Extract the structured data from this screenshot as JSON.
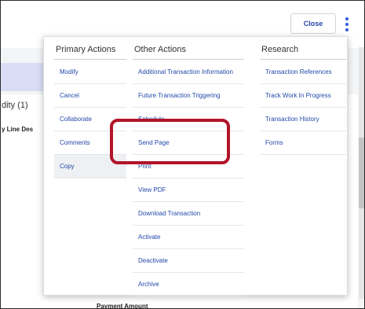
{
  "header": {
    "close_label": "Close"
  },
  "background": {
    "validity_label": "dity (1)",
    "line_desc_label": "y Line Des",
    "payment_amount_label": "Payment Amount"
  },
  "menu": {
    "primary": {
      "header": "Primary Actions",
      "items": [
        {
          "label": "Modify"
        },
        {
          "label": "Cancel"
        },
        {
          "label": "Collaborate"
        },
        {
          "label": "Comments"
        },
        {
          "label": "Copy"
        }
      ]
    },
    "other": {
      "header": "Other Actions",
      "items": [
        {
          "label": "Additional Transaction Information"
        },
        {
          "label": "Future Transaction Triggering"
        },
        {
          "label": "Schedule"
        },
        {
          "label": "Send Page"
        },
        {
          "label": "Print"
        },
        {
          "label": "View PDF"
        },
        {
          "label": "Download Transaction"
        },
        {
          "label": "Activate"
        },
        {
          "label": "Deactivate"
        },
        {
          "label": "Archive"
        }
      ]
    },
    "research": {
      "header": "Research",
      "items": [
        {
          "label": "Transaction References"
        },
        {
          "label": "Track Work In Progress"
        },
        {
          "label": "Transaction History"
        },
        {
          "label": "Forms"
        }
      ]
    }
  },
  "colors": {
    "accent": "#2348a8",
    "kebab": "#2f5bd8",
    "highlight": "#b2142a"
  }
}
